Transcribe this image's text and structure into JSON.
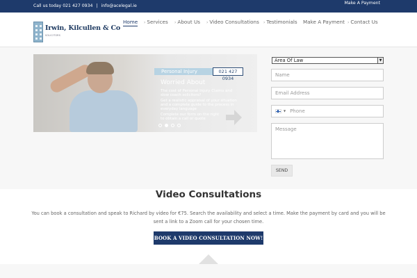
{
  "topbar": {
    "phone_text": "Call us today 021 427 0934",
    "separator": "|",
    "email": "info@acelegal.ie",
    "make_payment": "Make A Payment"
  },
  "logo": {
    "name": "Irwin, Kilcullen & Co",
    "tagline": "SOLICITORS"
  },
  "nav": {
    "items": [
      {
        "label": "Home",
        "chevron": false
      },
      {
        "label": "Services",
        "chevron": true
      },
      {
        "label": "About Us",
        "chevron": true
      },
      {
        "label": "Video Consultations",
        "chevron": true
      },
      {
        "label": "Testimonials",
        "chevron": true
      },
      {
        "label": "Make A Payment",
        "chevron": false
      },
      {
        "label": "Contact Us",
        "chevron": true
      }
    ],
    "chevron_glyph": "›"
  },
  "slider": {
    "banner": "Personal Injury",
    "phone": "021 427 0934",
    "heading": "Worried About",
    "lines": [
      "The cost of Personal Injury Claims and",
      "slow coach solicitors?",
      "Get a realistic appraisal of your situation",
      "and a complete guide to the process in",
      "everyday language",
      "Complete our form on the right",
      "to obtain a call or quote"
    ],
    "active_slide": 1,
    "slide_count": 4
  },
  "form": {
    "area_select": "Area Of Law",
    "name_placeholder": "Name",
    "email_placeholder": "Email Address",
    "phone_placeholder": "Phone",
    "message_placeholder": "Message",
    "send_label": "SEND"
  },
  "section": {
    "title": "Video Consultations",
    "text": "You can book a consultation and speak to Richard by video for €75. Search the availability and select a time. Make the payment by card and you will be sent a link to a Zoom call for your chosen time.",
    "cta_label": "BOOK A VIDEO CONSULTATION NOW!"
  },
  "colors": {
    "brand_navy": "#1e3a6b",
    "background_gray": "#f7f7f7"
  },
  "icons": {
    "arrow": "arrow-right-icon",
    "flag": "finland-flag-icon"
  }
}
